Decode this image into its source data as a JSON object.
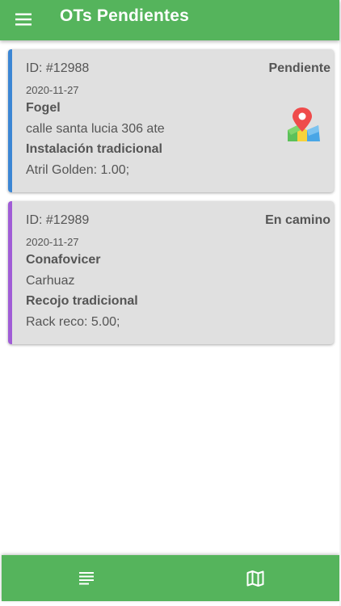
{
  "appbar": {
    "title": "OTs Pendientes",
    "menu_icon": "menu-icon",
    "color": "#55b45c"
  },
  "orders": [
    {
      "id": "ID: #12988",
      "status": "Pendiente",
      "date": "2020-11-27",
      "client": "Fogel",
      "address": "calle santa lucia 306 ate",
      "service": "Instalación tradicional",
      "items": "Atril Golden: 1.00;",
      "accent_color": "#3b86d4",
      "has_map_icon": true,
      "map_icon": "map-pin-icon"
    },
    {
      "id": "ID: #12989",
      "status": "En camino",
      "date": "2020-11-27",
      "client": "Conafovicer",
      "address": "Carhuaz",
      "service": "Recojo tradicional",
      "items": "Rack reco: 5.00;",
      "accent_color": "#a05cd6",
      "has_map_icon": false
    }
  ],
  "bottom_nav": {
    "items": [
      {
        "icon": "list-icon"
      },
      {
        "icon": "map-icon"
      }
    ]
  }
}
